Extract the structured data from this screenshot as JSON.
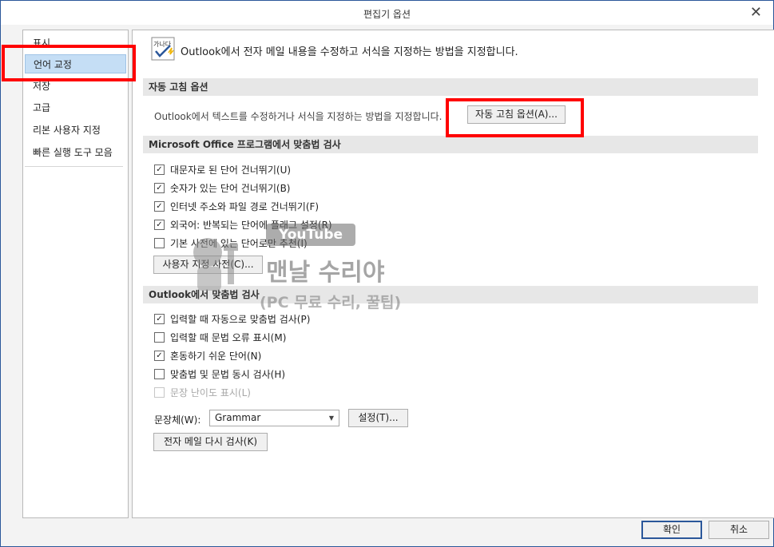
{
  "dialog": {
    "title": "편집기 옵션",
    "close_icon": "close-icon"
  },
  "sidebar": {
    "items": [
      {
        "label": "표시"
      },
      {
        "label": "언어 교정"
      },
      {
        "label": "저장"
      },
      {
        "label": "고급"
      },
      {
        "label": "리본 사용자 지정"
      },
      {
        "label": "빠른 실행 도구 모음"
      }
    ],
    "selected_index": 1
  },
  "header": {
    "icon": "proofing-abc-check-icon",
    "icon_text": "가나다",
    "text": "Outlook에서 전자 메일 내용을 수정하고 서식을 지정하는 방법을 지정합니다."
  },
  "autocorrect": {
    "section_title": "자동 고침 옵션",
    "description": "Outlook에서 텍스트를 수정하거나 서식을 지정하는 방법을 지정합니다.",
    "button_label": "자동 고침 옵션(A)..."
  },
  "office_spelling": {
    "section_title": "Microsoft Office 프로그램에서 맞춤법 검사",
    "options": [
      {
        "label": "대문자로 된 단어 건너뛰기(U)",
        "checked": "✓"
      },
      {
        "label": "숫자가 있는 단어 건너뛰기(B)",
        "checked": "✓"
      },
      {
        "label": "인터넷 주소와 파일 경로 건너뛰기(F)",
        "checked": "✓"
      },
      {
        "label": "외국어: 반복되는 단어에 플래그 설정(R)",
        "checked": "✓"
      },
      {
        "label": "기본 사전에 있는 단어로만 추천(I)",
        "checked": ""
      }
    ],
    "custom_dict_button": "사용자 지정 사전(C)..."
  },
  "outlook_spelling": {
    "section_title": "Outlook에서 맞춤법 검사",
    "options": [
      {
        "label": "입력할 때 자동으로 맞춤법 검사(P)",
        "checked": "✓"
      },
      {
        "label": "입력할 때 문법 오류 표시(M)",
        "checked": ""
      },
      {
        "label": "혼동하기 쉬운 단어(N)",
        "checked": "✓"
      },
      {
        "label": "맞춤법 및 문법 동시 검사(H)",
        "checked": ""
      },
      {
        "label": "문장 난이도 표시(L)",
        "checked": "",
        "disabled": true
      }
    ],
    "writing_style_label": "문장체(W):",
    "writing_style_value": "Grammar",
    "settings_button": "설정(T)...",
    "recheck_button": "전자 메일 다시 검사(K)"
  },
  "footer": {
    "ok_label": "확인",
    "cancel_label": "취소"
  },
  "watermark": {
    "badge": "YouTube",
    "title": "맨날 수리야",
    "subtitle": "(PC 무료 수리, 꿀팁)"
  },
  "colors": {
    "accent": "#2b579a",
    "highlight_box": "#ff0000",
    "selected_item": "#c5def5",
    "section_bg": "#e7e7e7"
  }
}
